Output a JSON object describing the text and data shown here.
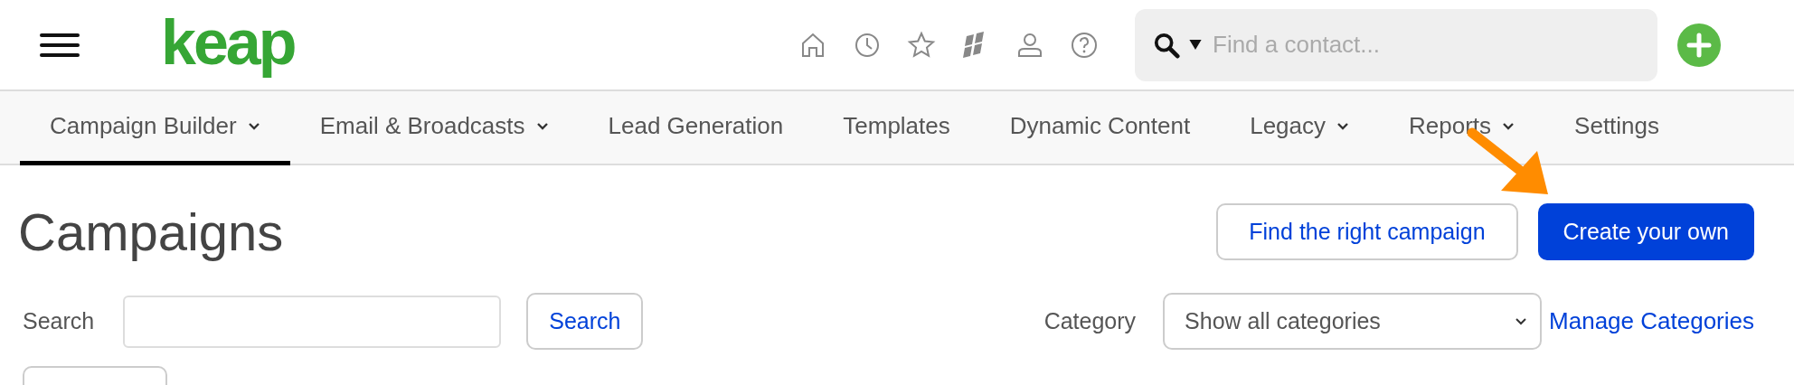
{
  "header": {
    "logo": "keap",
    "search": {
      "placeholder": "Find a contact..."
    }
  },
  "nav_tabs": [
    {
      "label": "Campaign Builder",
      "selected": true,
      "dropdown": true
    },
    {
      "label": "Email & Broadcasts",
      "selected": false,
      "dropdown": true
    },
    {
      "label": "Lead Generation",
      "selected": false,
      "dropdown": false
    },
    {
      "label": "Templates",
      "selected": false,
      "dropdown": false
    },
    {
      "label": "Dynamic Content",
      "selected": false,
      "dropdown": false
    },
    {
      "label": "Legacy",
      "selected": false,
      "dropdown": true
    },
    {
      "label": "Reports",
      "selected": false,
      "dropdown": true
    },
    {
      "label": "Settings",
      "selected": false,
      "dropdown": false
    }
  ],
  "page": {
    "title": "Campaigns",
    "buttons": [
      {
        "label": "Find the right campaign",
        "kind": "secondary"
      },
      {
        "label": "Create your own",
        "kind": "primary"
      }
    ],
    "search": {
      "label": "Search",
      "button": "Search"
    },
    "category": {
      "label": "Category",
      "value": "Show all categories",
      "link": "Manage Categories"
    }
  }
}
